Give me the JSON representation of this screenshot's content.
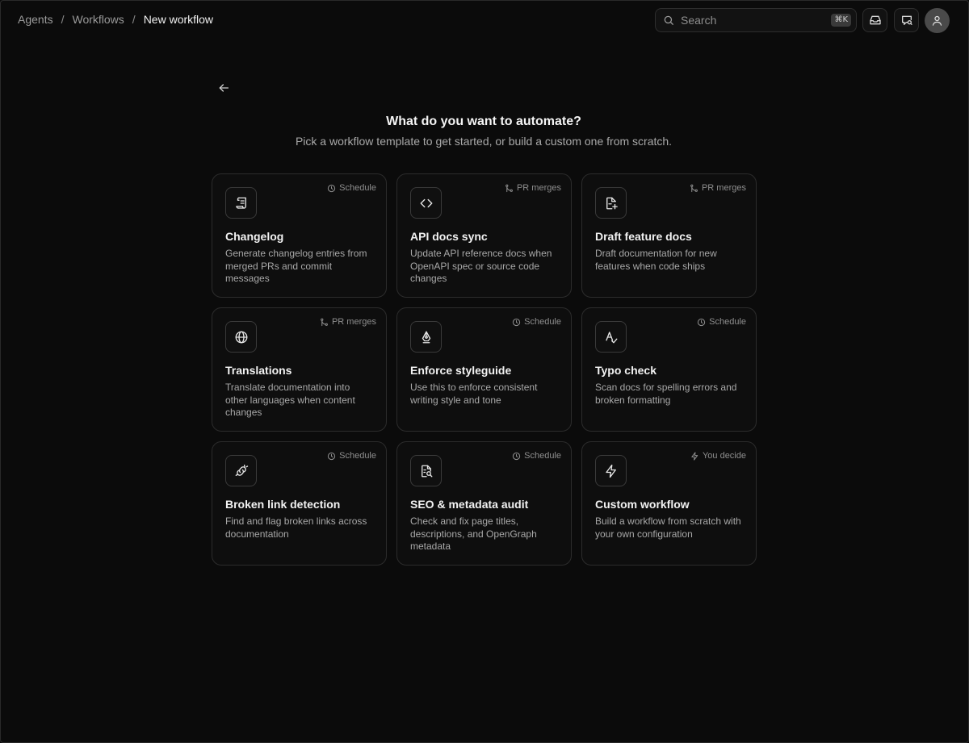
{
  "breadcrumb": {
    "items": [
      "Agents",
      "Workflows"
    ],
    "separator": "/",
    "current": "New workflow"
  },
  "search": {
    "placeholder": "Search",
    "shortcut": "⌘K"
  },
  "header": {
    "title": "What do you want to automate?",
    "subtitle": "Pick a workflow template to get started, or build a custom one from scratch."
  },
  "cards": [
    {
      "title": "Changelog",
      "description": "Generate changelog entries from merged PRs and commit messages",
      "trigger": "Schedule",
      "trigger_icon": "clock-icon",
      "icon": "scroll-icon"
    },
    {
      "title": "API docs sync",
      "description": "Update API reference docs when OpenAPI spec or source code changes",
      "trigger": "PR merges",
      "trigger_icon": "git-merge-icon",
      "icon": "code-icon"
    },
    {
      "title": "Draft feature docs",
      "description": "Draft documentation for new features when code ships",
      "trigger": "PR merges",
      "trigger_icon": "git-merge-icon",
      "icon": "file-plus-icon"
    },
    {
      "title": "Translations",
      "description": "Translate documentation into other languages when content changes",
      "trigger": "PR merges",
      "trigger_icon": "git-merge-icon",
      "icon": "globe-icon"
    },
    {
      "title": "Enforce styleguide",
      "description": "Use this to enforce consistent writing style and tone",
      "trigger": "Schedule",
      "trigger_icon": "clock-icon",
      "icon": "pen-nib-icon"
    },
    {
      "title": "Typo check",
      "description": "Scan docs for spelling errors and broken formatting",
      "trigger": "Schedule",
      "trigger_icon": "clock-icon",
      "icon": "spell-check-icon"
    },
    {
      "title": "Broken link detection",
      "description": "Find and flag broken links across documentation",
      "trigger": "Schedule",
      "trigger_icon": "clock-icon",
      "icon": "broken-link-icon"
    },
    {
      "title": "SEO & metadata audit",
      "description": "Check and fix page titles, descriptions, and OpenGraph metadata",
      "trigger": "Schedule",
      "trigger_icon": "clock-icon",
      "icon": "file-search-icon"
    },
    {
      "title": "Custom workflow",
      "description": "Build a workflow from scratch with your own configuration",
      "trigger": "You decide",
      "trigger_icon": "bolt-icon",
      "icon": "bolt-icon"
    }
  ],
  "colors": {
    "background": "#0b0b0b",
    "card_border": "#2c2c2c",
    "text_primary": "#f2f2f2",
    "text_secondary": "#a8a8a8"
  }
}
